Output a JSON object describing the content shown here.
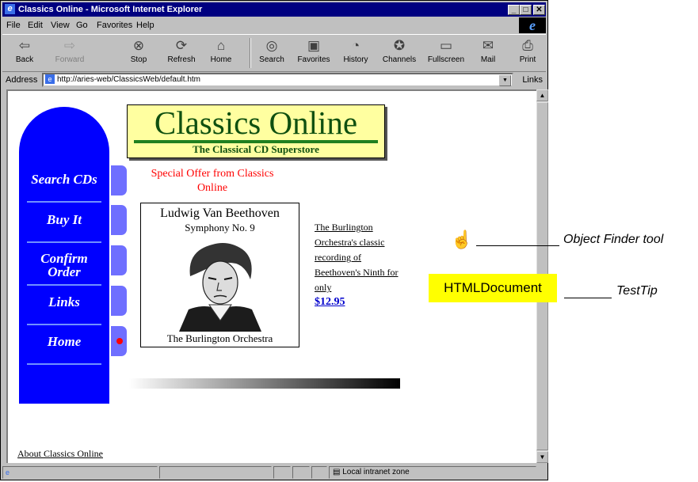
{
  "window": {
    "title": "Classics Online - Microsoft Internet Explorer",
    "controls": [
      "_",
      "□",
      "✕"
    ]
  },
  "menu": [
    "File",
    "Edit",
    "View",
    "Go",
    "Favorites",
    "Help"
  ],
  "toolbar": [
    {
      "label": "Back",
      "icon": "⇦",
      "name": "back"
    },
    {
      "label": "Forward",
      "icon": "⇨",
      "name": "forward"
    },
    {
      "label": "Stop",
      "icon": "⊗",
      "name": "stop"
    },
    {
      "label": "Refresh",
      "icon": "⟳",
      "name": "refresh"
    },
    {
      "label": "Home",
      "icon": "⌂",
      "name": "home"
    },
    {
      "label": "Search",
      "icon": "◎",
      "name": "search"
    },
    {
      "label": "Favorites",
      "icon": "▣",
      "name": "favorites"
    },
    {
      "label": "History",
      "icon": "◔",
      "name": "history"
    },
    {
      "label": "Channels",
      "icon": "✪",
      "name": "channels"
    },
    {
      "label": "Fullscreen",
      "icon": "▭",
      "name": "fullscreen"
    },
    {
      "label": "Mail",
      "icon": "✉",
      "name": "mail"
    },
    {
      "label": "Print",
      "icon": "⎙",
      "name": "print"
    }
  ],
  "address": {
    "label": "Address",
    "url": "http://aries-web/ClassicsWeb/default.htm",
    "links": "Links"
  },
  "page": {
    "banner_title": "Classics Online",
    "banner_subtitle": "The Classical CD Superstore",
    "nav": [
      "Search CDs",
      "Buy It",
      "Confirm Order",
      "Links",
      "Home"
    ],
    "offer": "Special Offer from Classics Online",
    "album": {
      "composer": "Ludwig Van Beethoven",
      "work": "Symphony No. 9",
      "orchestra": "The Burlington Orchestra"
    },
    "description": "The Burlington Orchestra's classic recording of Beethoven's Ninth for only",
    "price": "$12.95",
    "about_link": "About Classics Online"
  },
  "status": {
    "zone": "Local intranet zone"
  },
  "annotations": {
    "object_finder": "Object Finder tool",
    "testtip_label": "TestTip",
    "testtip_text": "HTMLDocument"
  }
}
